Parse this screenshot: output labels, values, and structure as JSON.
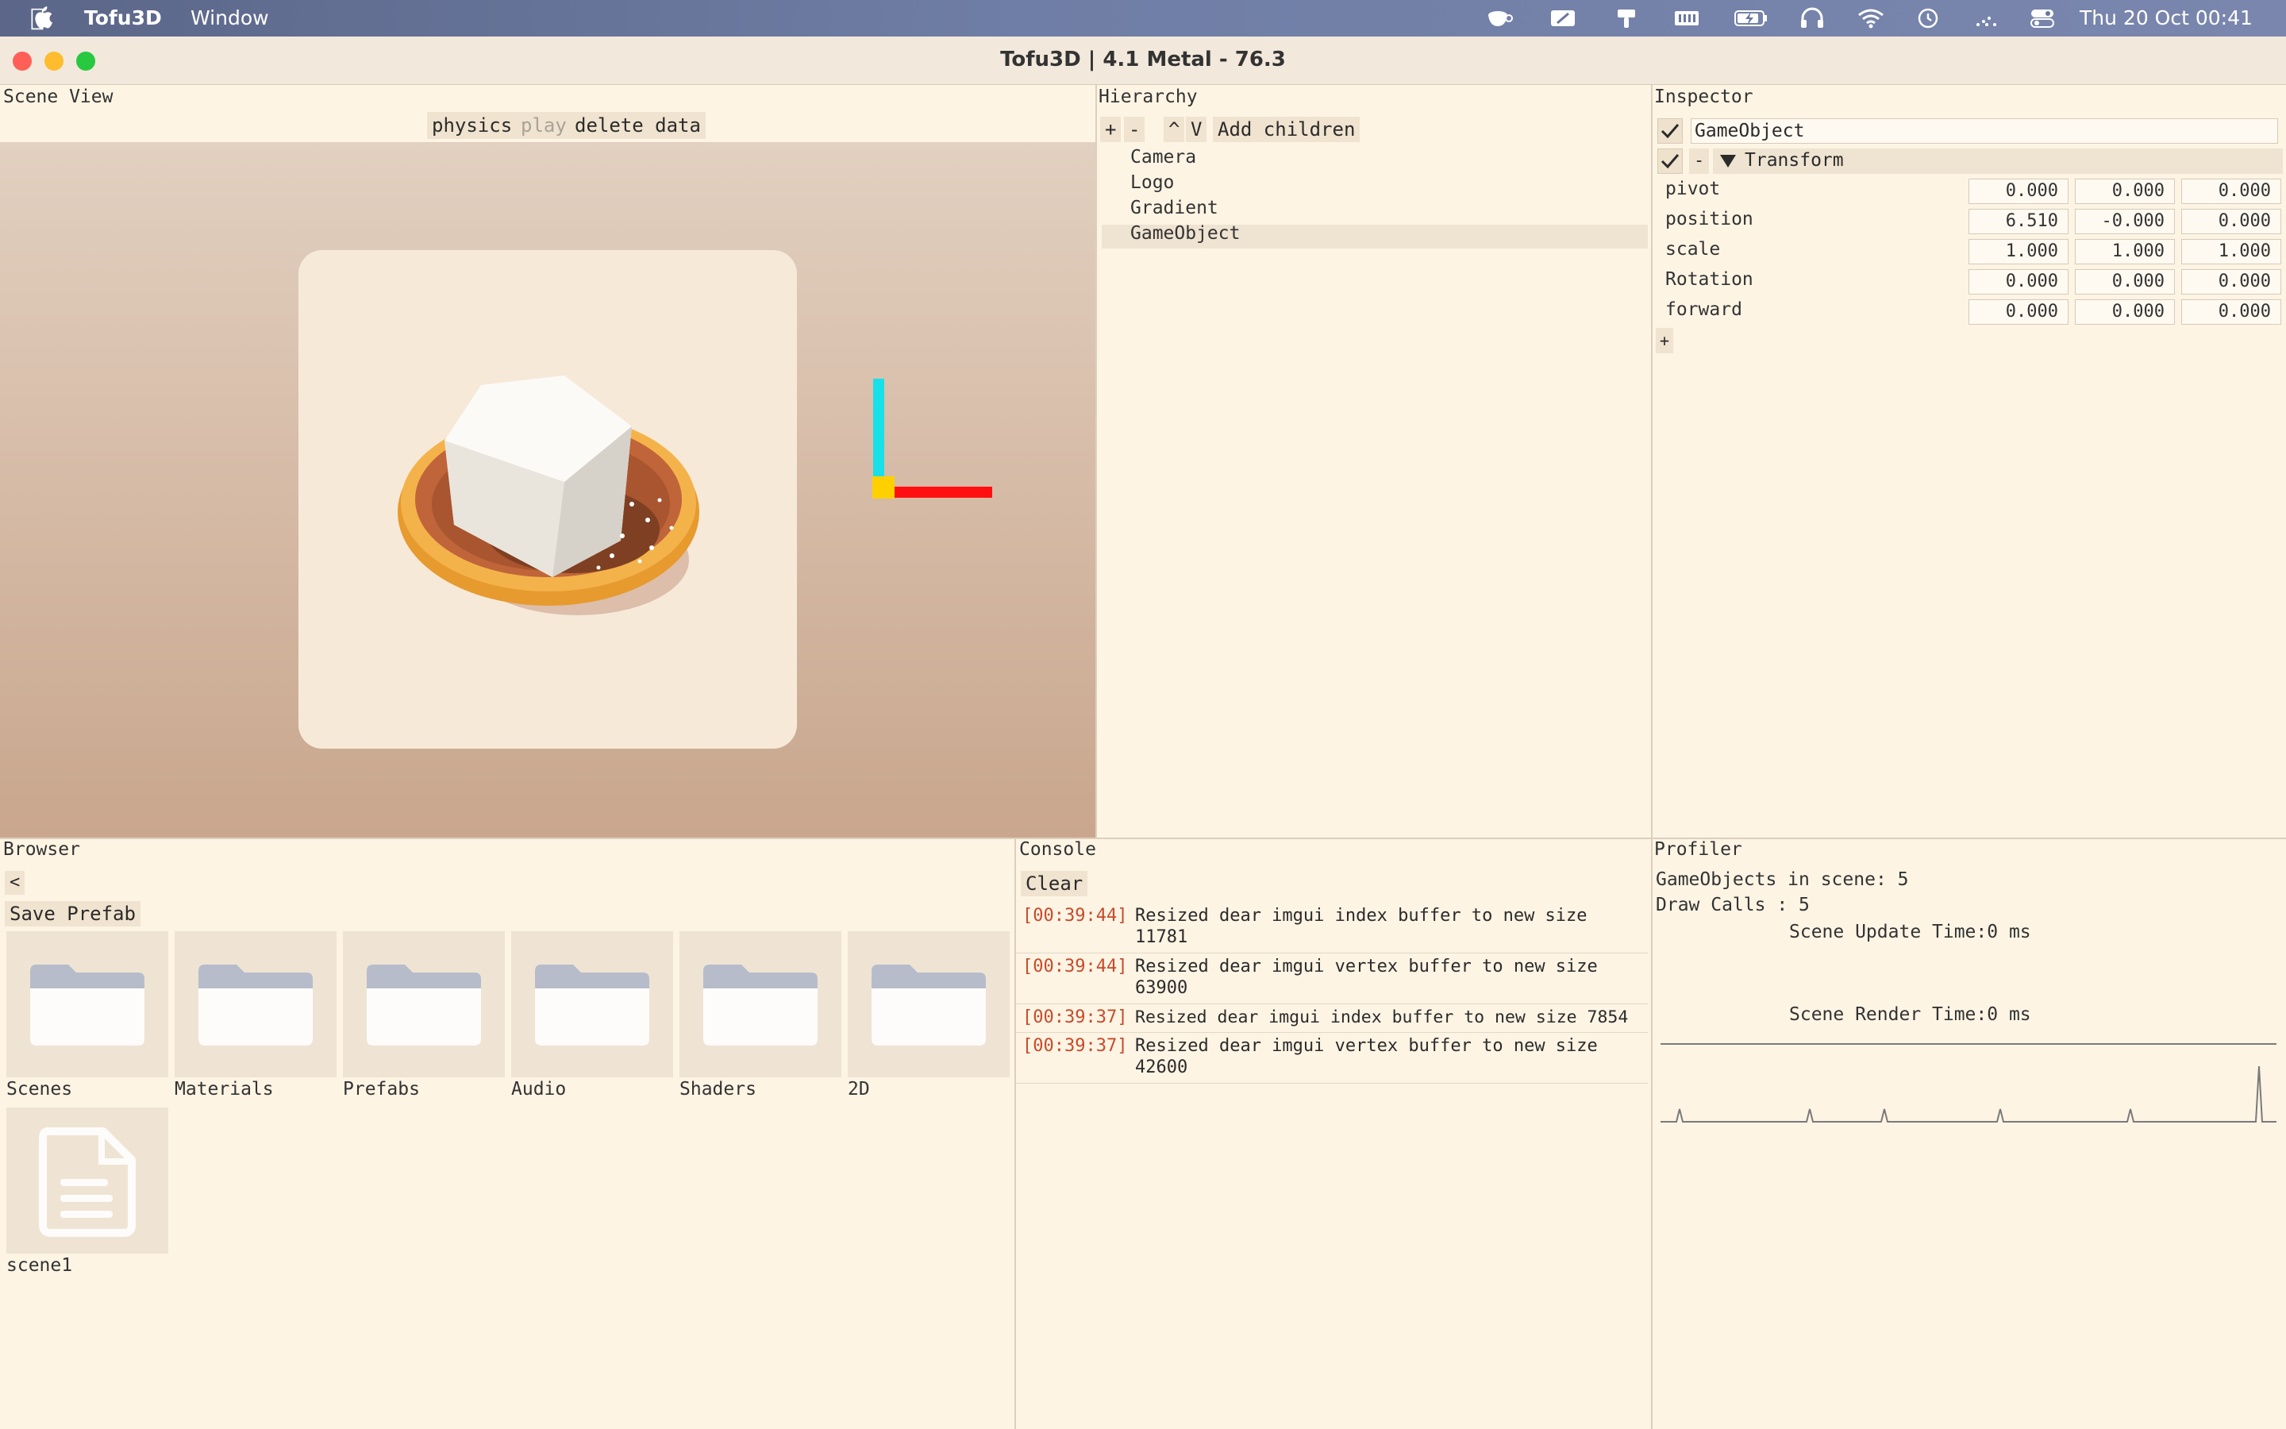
{
  "menubar": {
    "app_name": "Tofu3D",
    "menu_window": "Window",
    "clock": "Thu 20 Oct  00:41",
    "status_icons": [
      "coffee-cup-icon",
      "pen-tablet-icon",
      "brush-icon",
      "memory-icon",
      "battery-charging-icon",
      "headphones-icon",
      "wifi-icon",
      "time-machine-icon",
      "dots-icon",
      "control-center-icon"
    ]
  },
  "window": {
    "title": "Tofu3D | 4.1 Metal - 76.3"
  },
  "scene_view": {
    "title": "Scene View",
    "btn_physics": "physics",
    "btn_play": "play",
    "btn_delete": "delete data"
  },
  "hierarchy": {
    "title": "Hierarchy",
    "btn_add": "+",
    "btn_remove": "-",
    "btn_up": "^",
    "btn_down": "V",
    "btn_add_children": "Add children",
    "items": [
      "Camera",
      "Logo",
      "Gradient",
      "GameObject"
    ],
    "selected": "GameObject"
  },
  "inspector": {
    "title": "Inspector",
    "object_name": "GameObject",
    "component_minus": "-",
    "component_name": "Transform",
    "rows": [
      {
        "label": "pivot",
        "x": "0.000",
        "y": "0.000",
        "z": "0.000"
      },
      {
        "label": "position",
        "x": "6.510",
        "y": "-0.000",
        "z": "0.000"
      },
      {
        "label": "scale",
        "x": "1.000",
        "y": "1.000",
        "z": "1.000"
      },
      {
        "label": "Rotation",
        "x": "0.000",
        "y": "0.000",
        "z": "0.000"
      },
      {
        "label": "forward",
        "x": "0.000",
        "y": "0.000",
        "z": "0.000"
      }
    ],
    "btn_add_component": "+"
  },
  "browser": {
    "title": "Browser",
    "btn_back": "<",
    "btn_save_prefab": "Save Prefab",
    "folders": [
      "Scenes",
      "Materials",
      "Prefabs",
      "Audio",
      "Shaders",
      "2D"
    ],
    "files": [
      "scene1"
    ]
  },
  "console": {
    "title": "Console",
    "btn_clear": "Clear",
    "logs": [
      {
        "time": "[00:39:44]",
        "msg": "Resized dear imgui index buffer to new size 11781"
      },
      {
        "time": "[00:39:44]",
        "msg": "Resized dear imgui vertex buffer to new size 63900"
      },
      {
        "time": "[00:39:37]",
        "msg": "Resized dear imgui index buffer to new size 7854"
      },
      {
        "time": "[00:39:37]",
        "msg": "Resized dear imgui vertex buffer to new size 42600"
      }
    ]
  },
  "profiler": {
    "title": "Profiler",
    "gameobjects": "GameObjects in scene: 5",
    "draw_calls": "Draw Calls : 5",
    "update_time": "Scene Update Time:0 ms",
    "render_time": "Scene Render Time:0 ms"
  },
  "colors": {
    "accent_cyan": "#18e0e8",
    "accent_red": "#ff1010",
    "accent_yellow": "#ffd000",
    "log_timestamp": "#c84a2a",
    "panel_bg": "#fdf4e4"
  }
}
